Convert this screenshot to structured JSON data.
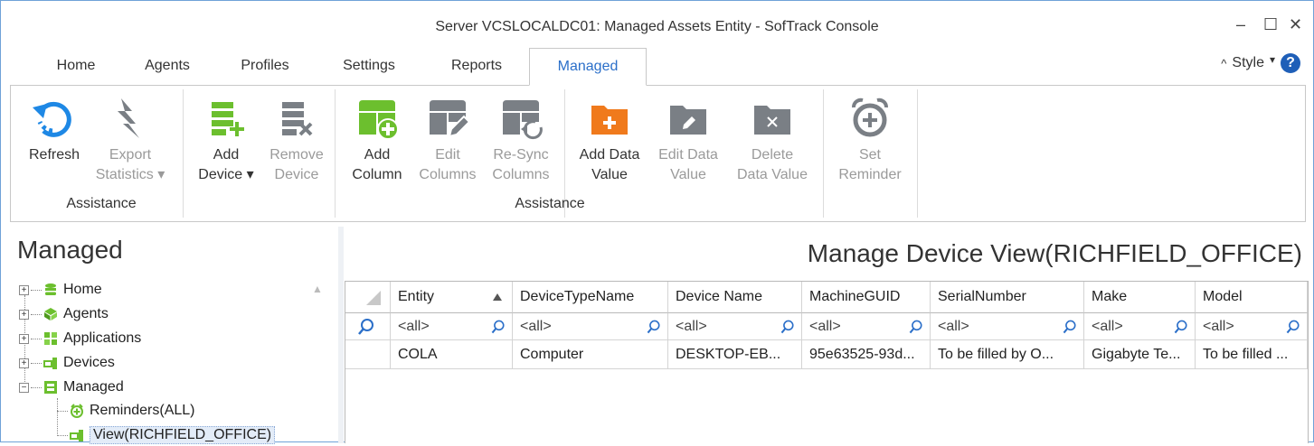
{
  "window": {
    "title": "Server VCSLOCALDC01: Managed Assets Entity - SofTrack Console",
    "minimize": "–",
    "maximize": "☐",
    "close": "✕"
  },
  "tabs": [
    {
      "label": "Home"
    },
    {
      "label": "Agents"
    },
    {
      "label": "Profiles"
    },
    {
      "label": "Settings"
    },
    {
      "label": "Reports"
    },
    {
      "label": "Managed",
      "active": true
    }
  ],
  "style_menu": {
    "chevron": "^",
    "label": "Style",
    "dropdown": "▾",
    "help": "?"
  },
  "ribbon": {
    "refresh": {
      "label": "Refresh",
      "icon": "refresh-icon"
    },
    "export": {
      "line1": "Export",
      "line2": "Statistics ▾",
      "icon": "export-icon"
    },
    "group1": "Assistance",
    "add_device": {
      "line1": "Add",
      "line2": "Device ▾",
      "icon": "add-device-icon"
    },
    "remove_device": {
      "line1": "Remove",
      "line2": "Device",
      "icon": "remove-device-icon"
    },
    "add_column": {
      "line1": "Add",
      "line2": "Column",
      "icon": "add-column-icon"
    },
    "edit_columns": {
      "line1": "Edit",
      "line2": "Columns",
      "icon": "edit-columns-icon"
    },
    "resync_columns": {
      "line1": "Re-Sync",
      "line2": "Columns",
      "icon": "resync-columns-icon"
    },
    "add_data_value": {
      "line1": "Add Data",
      "line2": "Value",
      "icon": "add-folder-icon"
    },
    "edit_data_value": {
      "line1": "Edit Data",
      "line2": "Value",
      "icon": "edit-folder-icon"
    },
    "delete_data_value": {
      "line1": "Delete",
      "line2": "Data Value",
      "icon": "delete-folder-icon"
    },
    "set_reminder": {
      "line1": "Set",
      "line2": "Reminder",
      "icon": "alarm-clock-icon"
    },
    "group2": "Assistance"
  },
  "left": {
    "title": "Managed",
    "tree": [
      {
        "label": "Home",
        "icon": "database-icon"
      },
      {
        "label": "Agents",
        "icon": "agents-icon"
      },
      {
        "label": "Applications",
        "icon": "applications-icon"
      },
      {
        "label": "Devices",
        "icon": "devices-icon"
      },
      {
        "label": "Managed",
        "icon": "managed-icon"
      },
      {
        "label": "Reminders(ALL)",
        "icon": "reminder-icon"
      },
      {
        "label": "View(RICHFIELD_OFFICE)",
        "icon": "view-icon"
      }
    ],
    "expand_plus": "+",
    "expand_minus": "−"
  },
  "right": {
    "title": "Manage Device View(RICHFIELD_OFFICE)",
    "columns": [
      "Entity",
      "DeviceTypeName",
      "Device Name",
      "MachineGUID",
      "SerialNumber",
      "Make",
      "Model"
    ],
    "filter_text": "<all>",
    "rows": [
      [
        "COLA",
        "Computer",
        "DESKTOP-EB...",
        "95e63525-93d...",
        "To be filled by O...",
        "Gigabyte Te...",
        "To be filled ..."
      ]
    ]
  },
  "colors": {
    "accent": "#2b6fc9",
    "green": "#6cbf2e",
    "orange": "#f07a1c",
    "gray_icon": "#7a7f85"
  }
}
